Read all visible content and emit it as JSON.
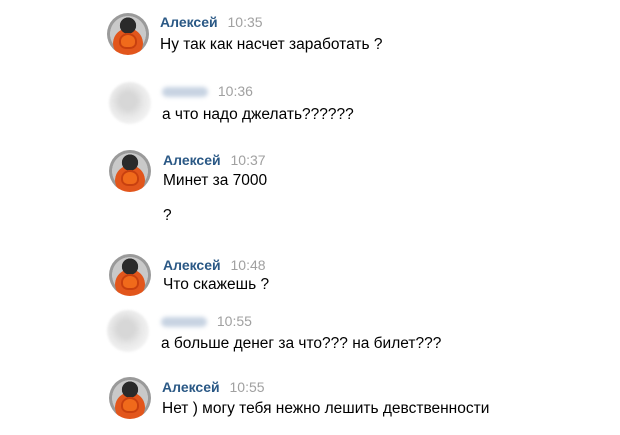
{
  "colors": {
    "author": "#2a5885",
    "time": "#a0a0a0",
    "text": "#000000",
    "background": "#ffffff"
  },
  "messages": [
    {
      "author": "Алексей",
      "time": "10:35",
      "lines": [
        "Ну так как насчет заработать ?"
      ],
      "avatar": "avatar-alexey"
    },
    {
      "author": "",
      "time": "10:36",
      "lines": [
        "а что надо джелать??????"
      ],
      "avatar": "avatar-blurred"
    },
    {
      "author": "Алексей",
      "time": "10:37",
      "lines": [
        "Минет за 7000",
        "?"
      ],
      "avatar": "avatar-alexey"
    },
    {
      "author": "Алексей",
      "time": "10:48",
      "lines": [
        "Что скажешь ?"
      ],
      "avatar": "avatar-alexey"
    },
    {
      "author": "",
      "time": "10:55",
      "lines": [
        "а больше денег за что??? на билет???"
      ],
      "avatar": "avatar-blurred"
    },
    {
      "author": "Алексей",
      "time": "10:55",
      "lines": [
        "Нет ) могу тебя нежно лешить девственности"
      ],
      "avatar": "avatar-alexey"
    }
  ]
}
